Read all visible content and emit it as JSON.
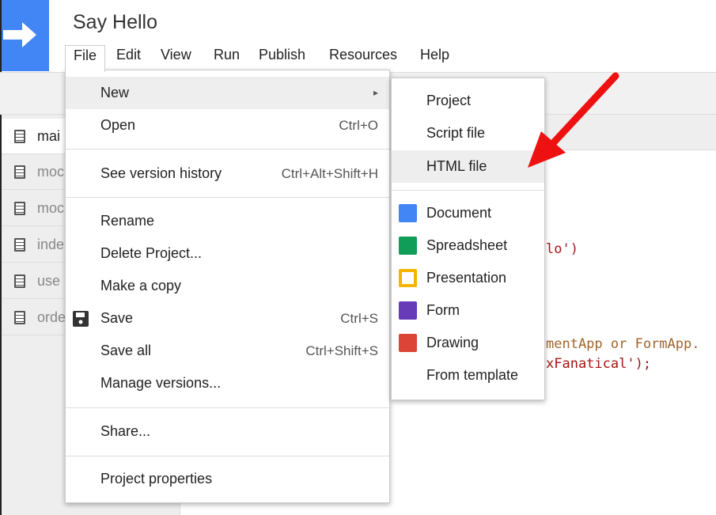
{
  "header": {
    "title": "Say Hello"
  },
  "menubar": [
    "File",
    "Edit",
    "View",
    "Run",
    "Publish",
    "Resources",
    "Help"
  ],
  "sidebar": {
    "files": [
      "mai",
      "moc",
      "moc",
      "inde",
      "use",
      "orde"
    ]
  },
  "code": {
    "line1": "lo')",
    "line2": "mentApp or FormApp.",
    "line3": "xFanatical');"
  },
  "file_menu": {
    "new": "New",
    "new_arrow": "▸",
    "open": "Open",
    "open_sc": "Ctrl+O",
    "history": "See version history",
    "history_sc": "Ctrl+Alt+Shift+H",
    "rename": "Rename",
    "delete": "Delete Project...",
    "copy": "Make a copy",
    "save": "Save",
    "save_sc": "Ctrl+S",
    "save_all": "Save all",
    "save_all_sc": "Ctrl+Shift+S",
    "versions": "Manage versions...",
    "share": "Share...",
    "properties": "Project properties"
  },
  "new_submenu": {
    "project": "Project",
    "script": "Script file",
    "html": "HTML file",
    "document": "Document",
    "spreadsheet": "Spreadsheet",
    "presentation": "Presentation",
    "form": "Form",
    "drawing": "Drawing",
    "template": "From template"
  },
  "colors": {
    "brand": "#4285f4",
    "docs": "#4285f4",
    "sheets": "#0f9d58",
    "slides": "#f4b400",
    "forms": "#673ab7",
    "drawings": "#db4437",
    "annotation_arrow": "#ee1111",
    "code_string": "#a31515",
    "code_comment": "#a0642d"
  }
}
